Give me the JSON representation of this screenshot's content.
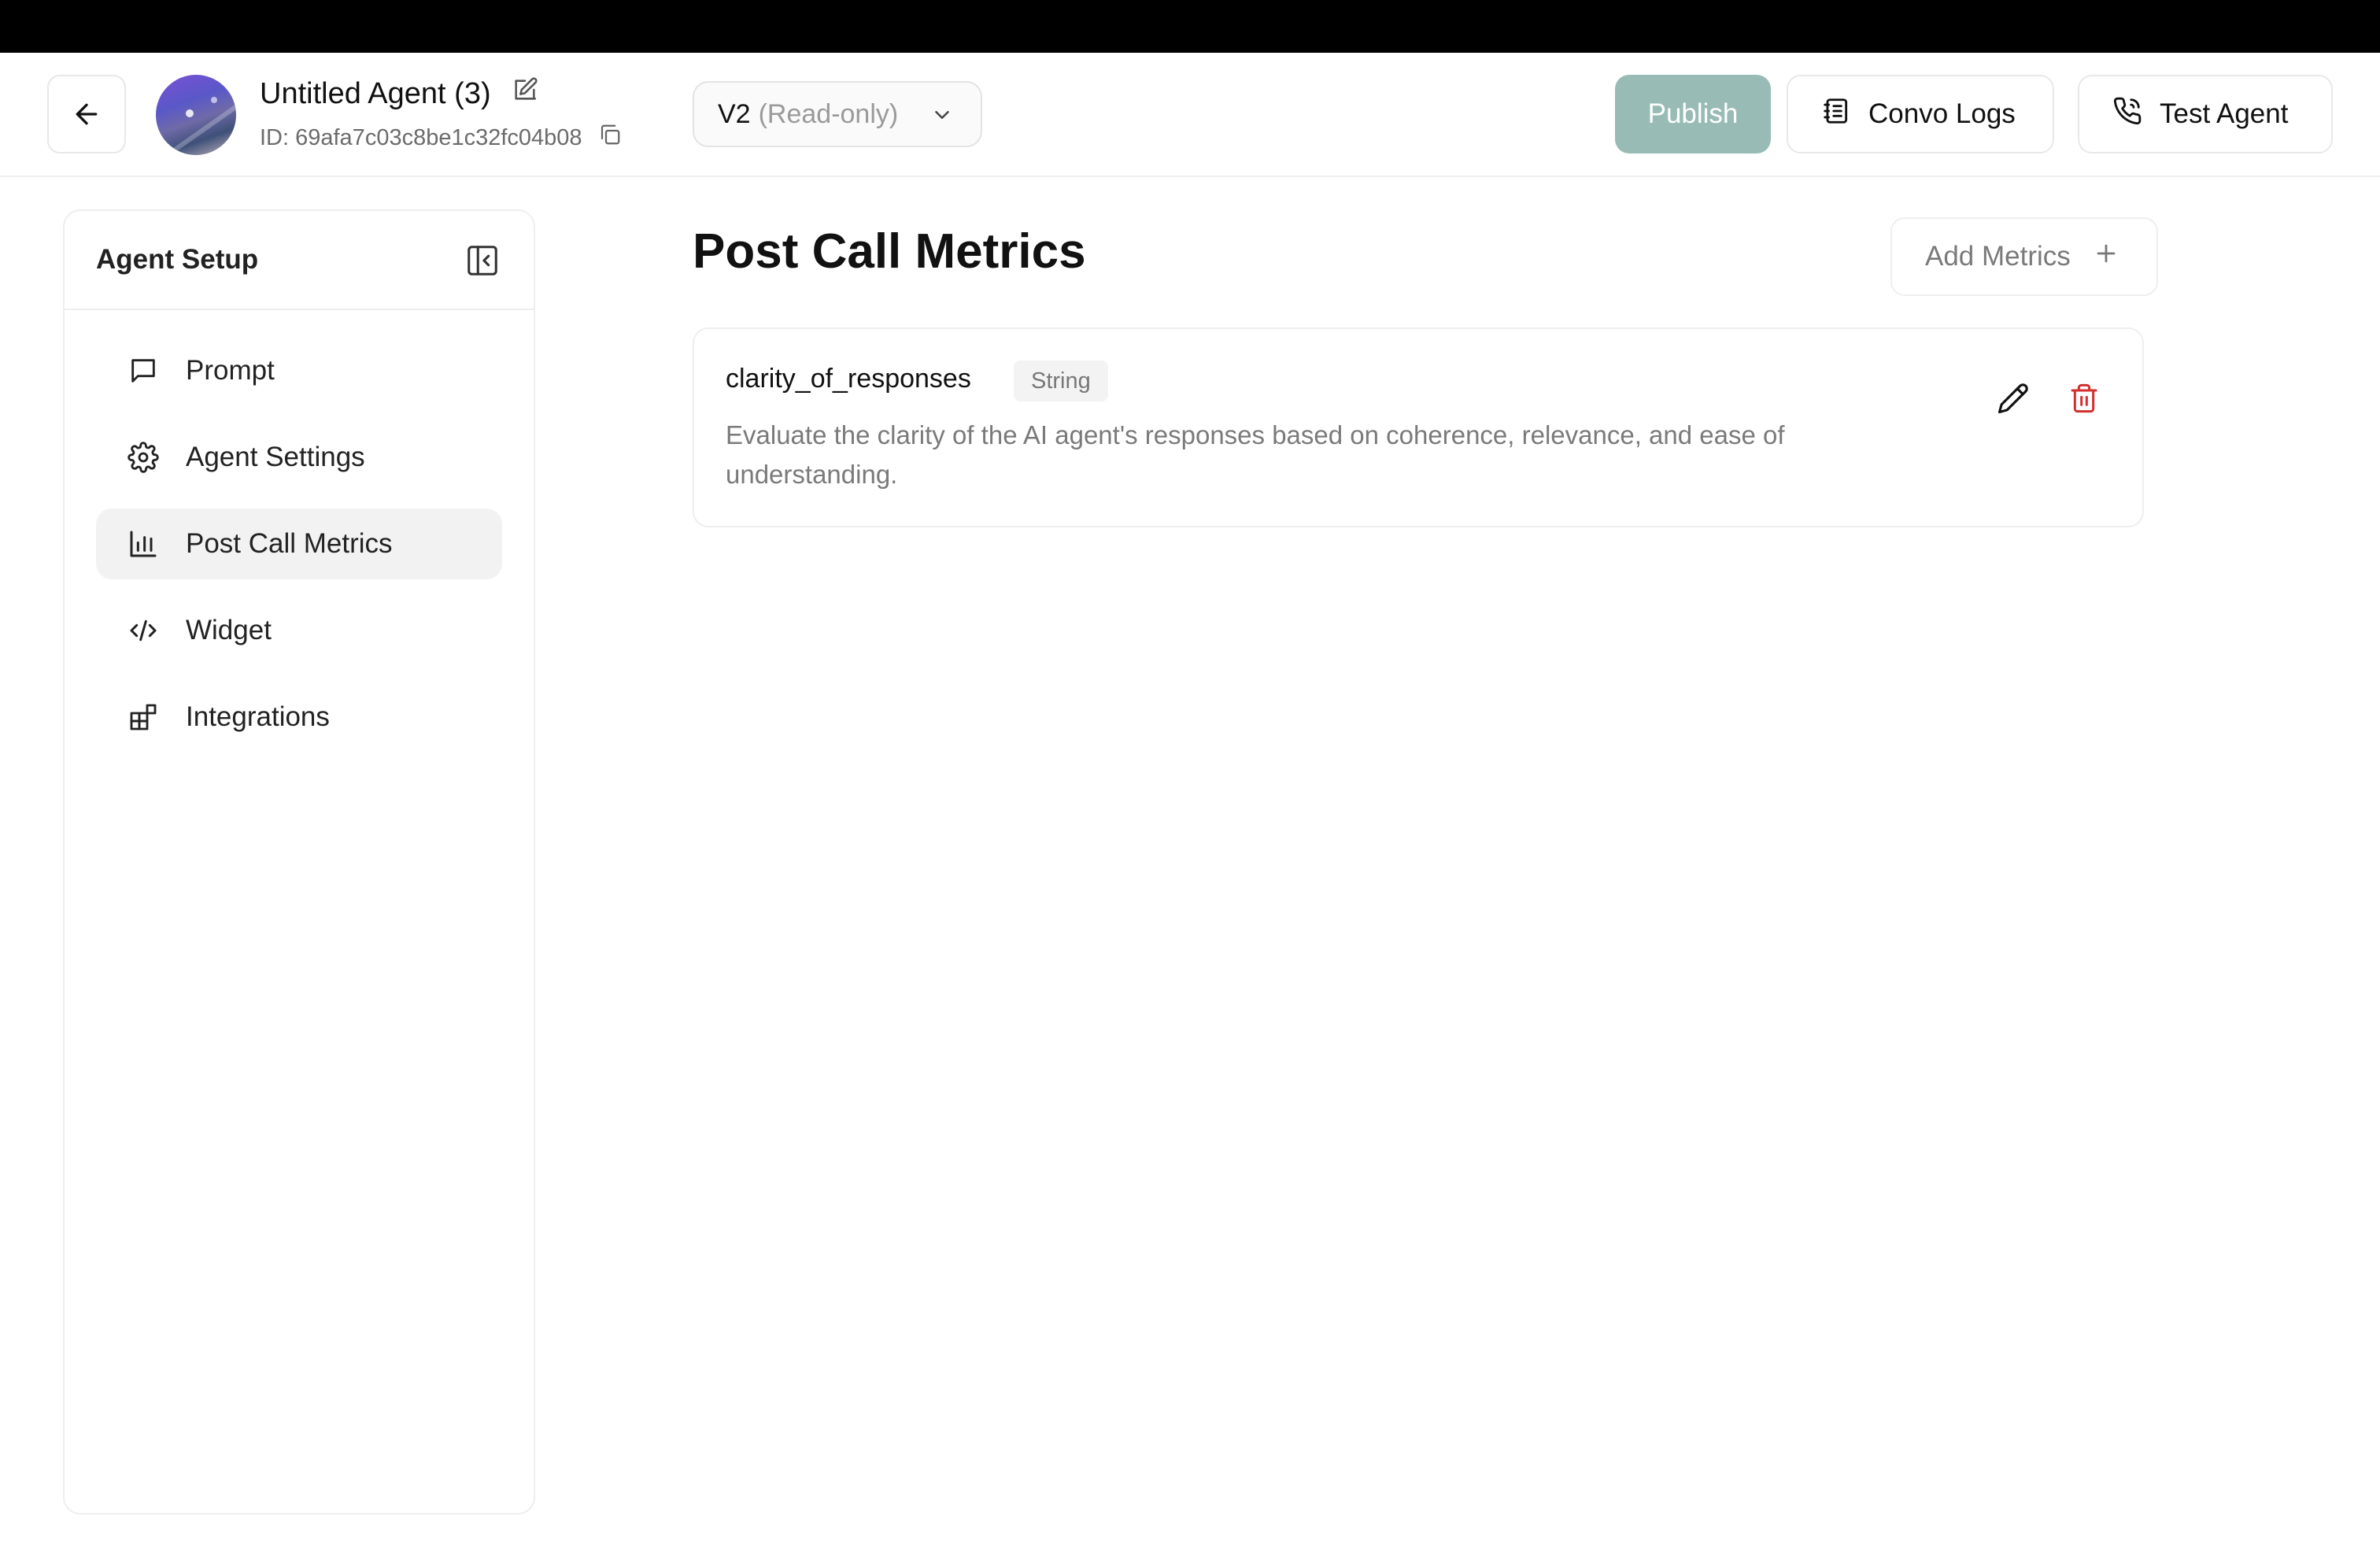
{
  "header": {
    "agent_name": "Untitled Agent (3)",
    "agent_id": "ID: 69afa7c03c8be1c32fc04b08",
    "version": {
      "label": "V2",
      "mode": "(Read-only)"
    },
    "publish_label": "Publish",
    "convo_logs_label": "Convo Logs",
    "test_agent_label": "Test Agent"
  },
  "sidebar": {
    "title": "Agent Setup",
    "items": [
      {
        "label": "Prompt",
        "icon": "chat-bubble-icon"
      },
      {
        "label": "Agent Settings",
        "icon": "gear-icon"
      },
      {
        "label": "Post Call Metrics",
        "icon": "bar-chart-icon",
        "active": true
      },
      {
        "label": "Widget",
        "icon": "code-icon"
      },
      {
        "label": "Integrations",
        "icon": "integrations-icon"
      }
    ]
  },
  "main": {
    "title": "Post Call Metrics",
    "add_metrics_label": "Add Metrics",
    "metrics": [
      {
        "name": "clarity_of_responses",
        "type": "String",
        "description": "Evaluate the clarity of the AI agent's responses based on coherence, relevance, and ease of understanding."
      }
    ]
  },
  "colors": {
    "publish_bg": "#98bcb5",
    "delete_icon": "#d32f2f",
    "active_nav_bg": "#f2f2f2"
  }
}
